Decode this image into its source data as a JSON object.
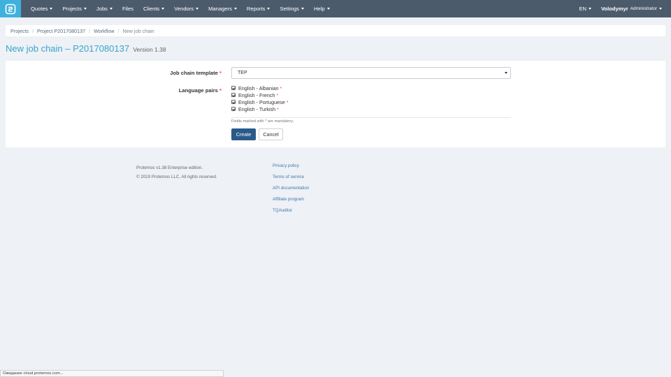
{
  "nav": {
    "items": [
      {
        "label": "Quotes",
        "dropdown": true
      },
      {
        "label": "Projects",
        "dropdown": true
      },
      {
        "label": "Jobs",
        "dropdown": true
      },
      {
        "label": "Files",
        "dropdown": false
      },
      {
        "label": "Clients",
        "dropdown": true
      },
      {
        "label": "Vendors",
        "dropdown": true
      },
      {
        "label": "Managers",
        "dropdown": true
      },
      {
        "label": "Reports",
        "dropdown": true
      },
      {
        "label": "Settings",
        "dropdown": true
      },
      {
        "label": "Help",
        "dropdown": true
      }
    ],
    "language": "EN",
    "user_name": "Volodymyr",
    "user_role": "Administrator"
  },
  "breadcrumb": {
    "items": [
      "Projects",
      "Project P2017080137",
      "Workflow"
    ],
    "active": "New job chain"
  },
  "page": {
    "title": "New job chain – P2017080137",
    "version": "Version 1.38"
  },
  "form": {
    "template_label": "Job chain template",
    "template_value": "TEP",
    "pairs_label": "Language pairs",
    "required_mark": "*",
    "pairs": [
      "English - Albanian",
      "English - French",
      "English - Portuguese",
      "English - Turkish"
    ],
    "note_before": "Fields marked with",
    "note_after": "are mandatory.",
    "create_label": "Create",
    "cancel_label": "Cancel"
  },
  "footer": {
    "edition": "Protemos v1.38 Enterprise edition.",
    "copyright": "© 2019 Protemos LLC. All rights reserved.",
    "links": [
      "Privacy policy",
      "Terms of service",
      "API documentation",
      "Affiliate program",
      "TQAuditor"
    ]
  },
  "status": {
    "text": "Ожидание cloud.protemos.com..."
  },
  "colors": {
    "navbar": "#4c5b6c",
    "logo": "#3fb1dc",
    "title": "#38a5cb",
    "primary_button": "#2a5a8a",
    "required": "#d9534f"
  }
}
